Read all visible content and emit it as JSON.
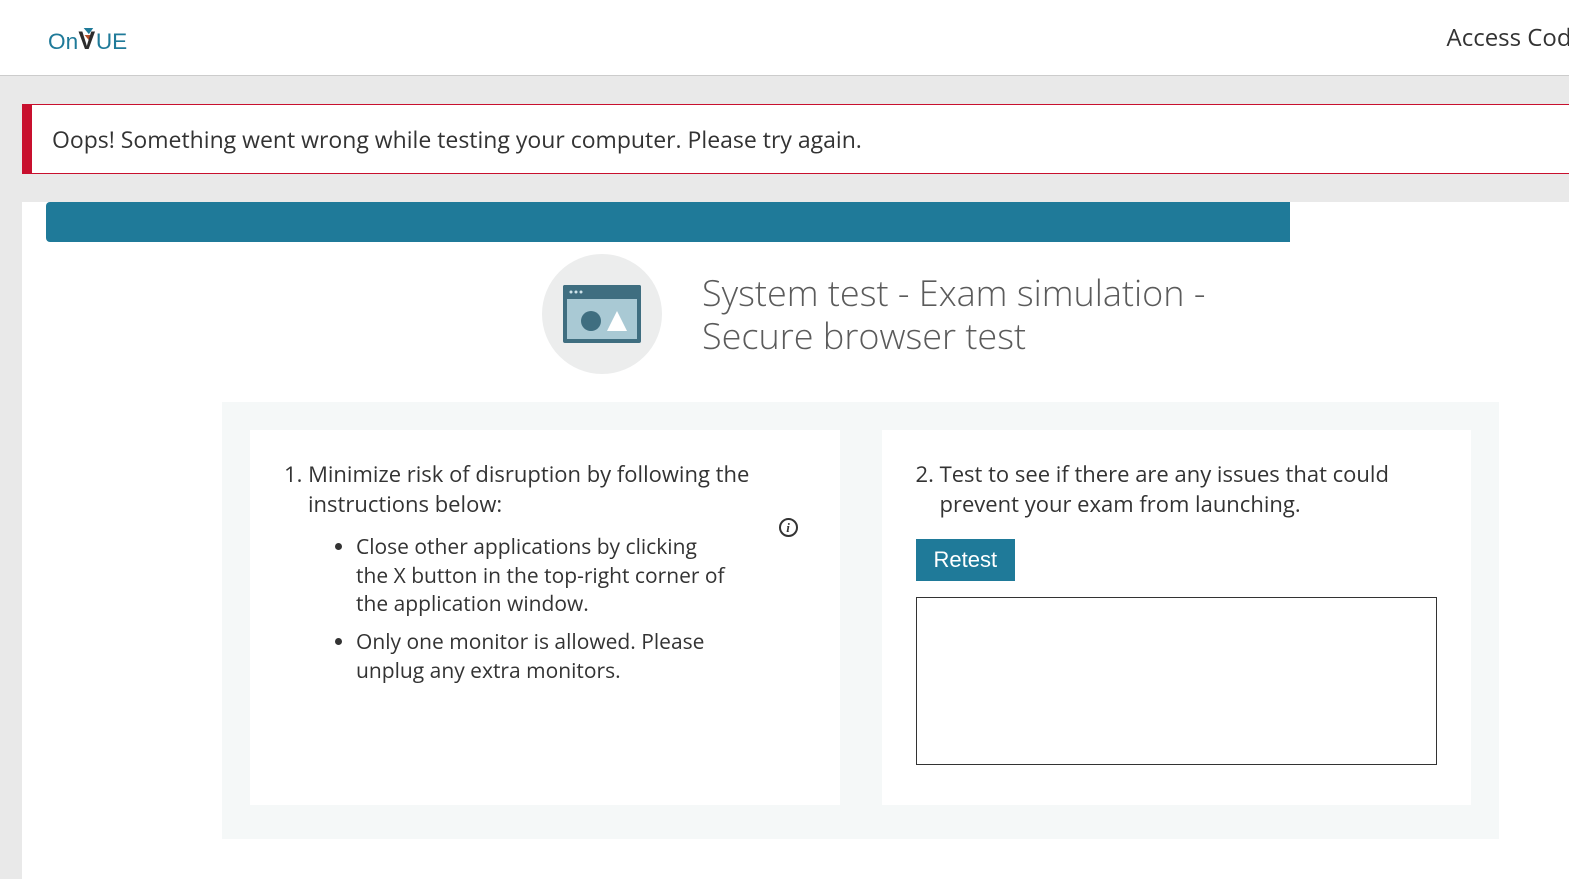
{
  "header": {
    "logo_text": "OnVUE",
    "access_code_label": "Access Code"
  },
  "alert": {
    "message": "Oops! Something went wrong while testing your computer. Please try again."
  },
  "progress": {
    "percent": 83
  },
  "main": {
    "title": "System test - Exam simulation - Secure browser test",
    "icon": "browser-window-icon"
  },
  "step1": {
    "heading": "1. Minimize risk of disruption by following the instructions below:",
    "bullets": [
      "Close other applications by clicking the X button in the top-right corner of the application window.",
      "Only one monitor is allowed. Please unplug any extra monitors."
    ],
    "info_tooltip": "i"
  },
  "step2": {
    "heading": "2. Test to see if there are any issues that could prevent your exam from launching.",
    "retest_label": "Retest"
  },
  "colors": {
    "accent": "#1f7a99",
    "alert_border": "#c8102e"
  }
}
